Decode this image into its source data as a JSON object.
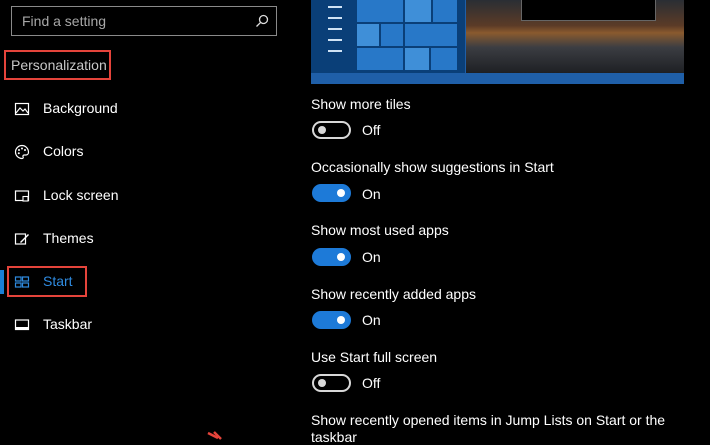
{
  "search": {
    "placeholder": "Find a setting",
    "icon": "search-icon"
  },
  "sidebar": {
    "section_title": "Personalization",
    "items": [
      {
        "label": "Background",
        "icon": "picture-icon"
      },
      {
        "label": "Colors",
        "icon": "palette-icon"
      },
      {
        "label": "Lock screen",
        "icon": "lock-screen-icon"
      },
      {
        "label": "Themes",
        "icon": "themes-icon"
      },
      {
        "label": "Start",
        "icon": "start-grid-icon",
        "active": true
      },
      {
        "label": "Taskbar",
        "icon": "taskbar-icon"
      }
    ]
  },
  "settings": [
    {
      "label": "Show more tiles",
      "state": "Off"
    },
    {
      "label": "Occasionally show suggestions in Start",
      "state": "On"
    },
    {
      "label": "Show most used apps",
      "state": "On"
    },
    {
      "label": "Show recently added apps",
      "state": "On"
    },
    {
      "label": "Use Start full screen",
      "state": "Off"
    },
    {
      "label": "Show recently opened items in Jump Lists on Start or the",
      "label_line2": "taskbar"
    }
  ],
  "colors": {
    "accent": "#1d7ad8",
    "highlight_border": "#e5443b",
    "active_text": "#2f8be0"
  }
}
